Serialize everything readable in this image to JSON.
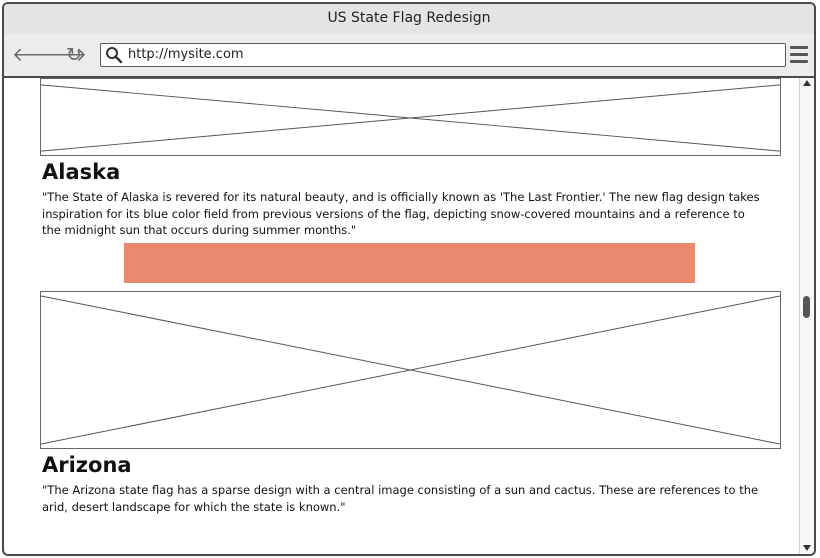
{
  "window": {
    "title": "US State Flag Redesign"
  },
  "toolbar": {
    "url": "http://mysite.com",
    "icons": [
      "back-arrow-icon",
      "forward-arrow-icon",
      "reload-icon",
      "search-icon",
      "hamburger-menu-icon"
    ]
  },
  "states": [
    {
      "name": "Alaska",
      "description": "\"The State of Alaska is revered for its natural beauty, and is officially known as 'The Last Frontier.' The new flag design takes inspiration for its blue color field from previous versions of the flag, depicting snow-covered mountains and a reference to the midnight sun that occurs during summer months.\""
    },
    {
      "name": "Arizona",
      "description": "\"The Arizona state flag has a sparse design with a central image consisting of a sun and cactus. These are references to the arid, desert landscape for which the state is known.\""
    }
  ],
  "colors": {
    "accent_bar": "#e98a6e",
    "placeholder_border": "#666666",
    "chrome": "#ececec"
  }
}
